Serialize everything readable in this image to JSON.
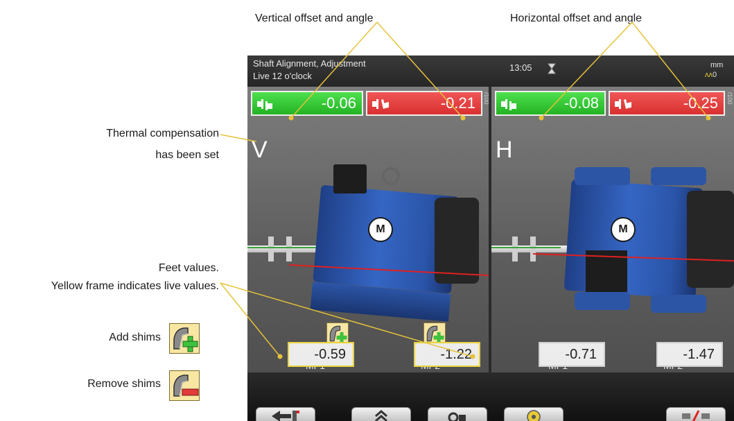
{
  "annotations": {
    "vertical": "Vertical offset and angle",
    "horizontal": "Horizontal offset and angle",
    "thermal_line1": "Thermal compensation",
    "thermal_line2": "has been set",
    "feet_line1": "Feet values.",
    "feet_line2": "Yellow frame indicates live values.",
    "add_shims": "Add shims",
    "remove_shims": "Remove shims"
  },
  "screen": {
    "title_line1": "Shaft Alignment, Adjustment",
    "title_line2": "Live 12 o'clock",
    "time": "13:05",
    "unit": "mm",
    "thermal_indicator": "0",
    "per100": "/100"
  },
  "vertical": {
    "label": "V",
    "offset": "-0.06",
    "angle": "-0.21",
    "motor_label": "M",
    "feet": [
      {
        "label": "MF1",
        "value": "-0.59",
        "live": true
      },
      {
        "label": "MF2",
        "value": "-1.22",
        "live": true
      }
    ]
  },
  "horizontal": {
    "label": "H",
    "offset": "-0.08",
    "angle": "-0.25",
    "motor_label": "M",
    "feet": [
      {
        "label": "MF1",
        "value": "-0.71",
        "live": false
      },
      {
        "label": "MF2",
        "value": "-1.47",
        "live": false
      }
    ]
  },
  "colors": {
    "accent_yellow": "#e6c93a",
    "offset_green": "#3ccf3c",
    "angle_red": "#e04444",
    "motor_blue": "#2d5cb8"
  },
  "icons": {
    "offset": "coupling-offset-icon",
    "angle": "coupling-angle-icon",
    "timer": "hourglass-icon",
    "thermal": "thermal-compensation-icon",
    "add_shims": "add-shims-icon",
    "remove_shims": "remove-shims-icon",
    "back": "back-arrow-icon",
    "up": "double-chevron-up-icon",
    "lock": "lock-icon",
    "settings": "gear-wheel-icon",
    "flip": "flip-coupling-icon"
  }
}
